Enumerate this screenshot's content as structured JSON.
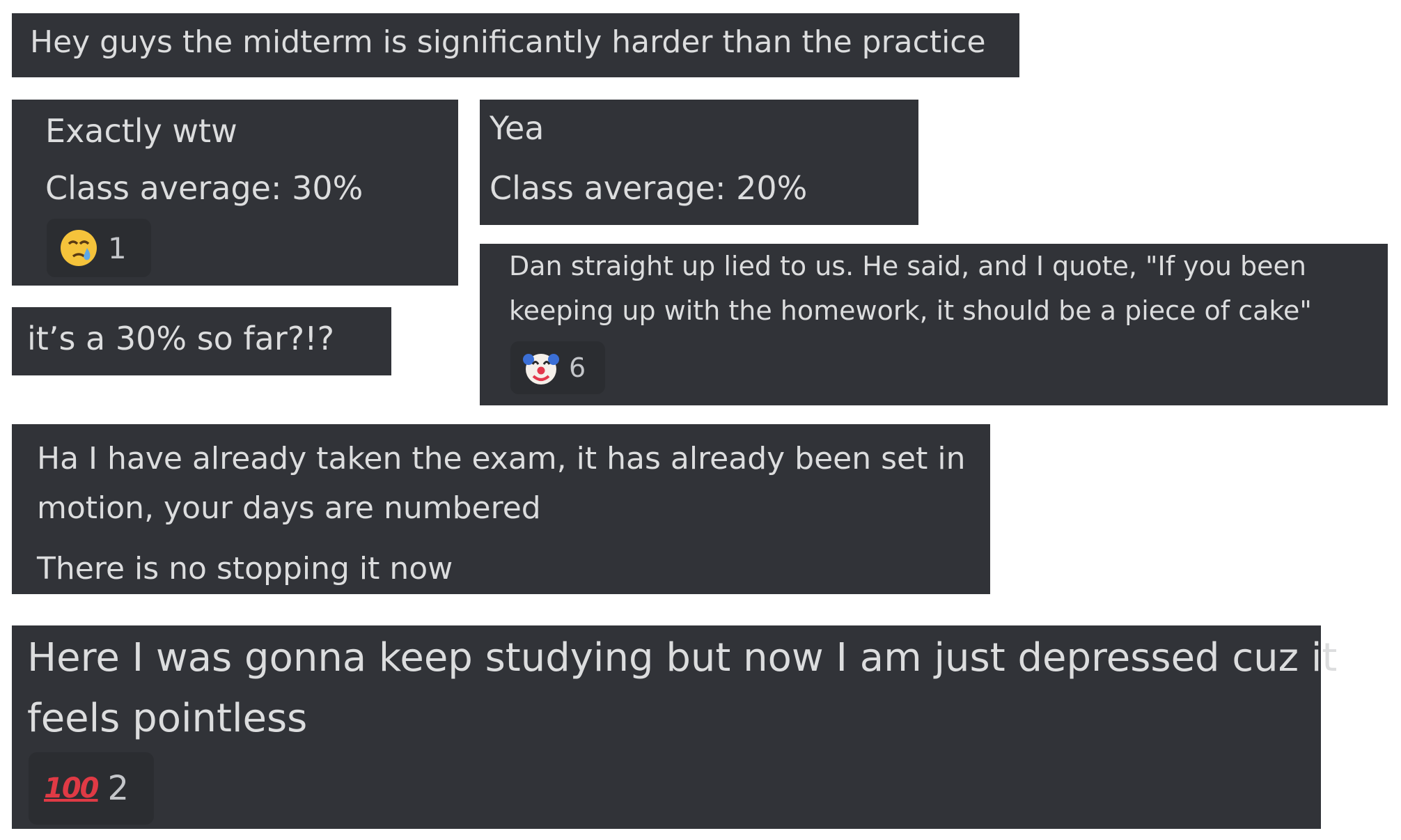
{
  "messages": {
    "m1": {
      "text": "Hey guys the midterm is significantly harder than the practice"
    },
    "m2": {
      "line1": "Exactly wtw",
      "line2": "Class average: 30%",
      "reaction": {
        "icon": "crying-face-icon",
        "count": "1"
      }
    },
    "m3": {
      "line1": "Yea",
      "line2": "Class average: 20%"
    },
    "m4": {
      "text": "it’s a 30% so far?!?"
    },
    "m5": {
      "line1": "Dan straight up lied to us. He said, and I quote, \"If you been",
      "line2": "keeping up with the homework, it should be a piece of cake\"",
      "reaction": {
        "icon": "clown-face-icon",
        "count": "6"
      }
    },
    "m6": {
      "line1": "Ha I have already taken the exam, it has already been set in",
      "line2": "motion, your days are numbered",
      "line3": "There is no stopping it now"
    },
    "m7": {
      "line1": "Here I was gonna keep studying but now I am just depressed cuz it",
      "line2": "feels pointless",
      "reaction": {
        "icon": "hundred-points-icon",
        "glyph": "100",
        "count": "2"
      }
    }
  },
  "colors": {
    "card_bg": "#313338",
    "reaction_bg": "#2b2d31",
    "text": "#dcddde",
    "hundred_red": "#e03a45"
  }
}
